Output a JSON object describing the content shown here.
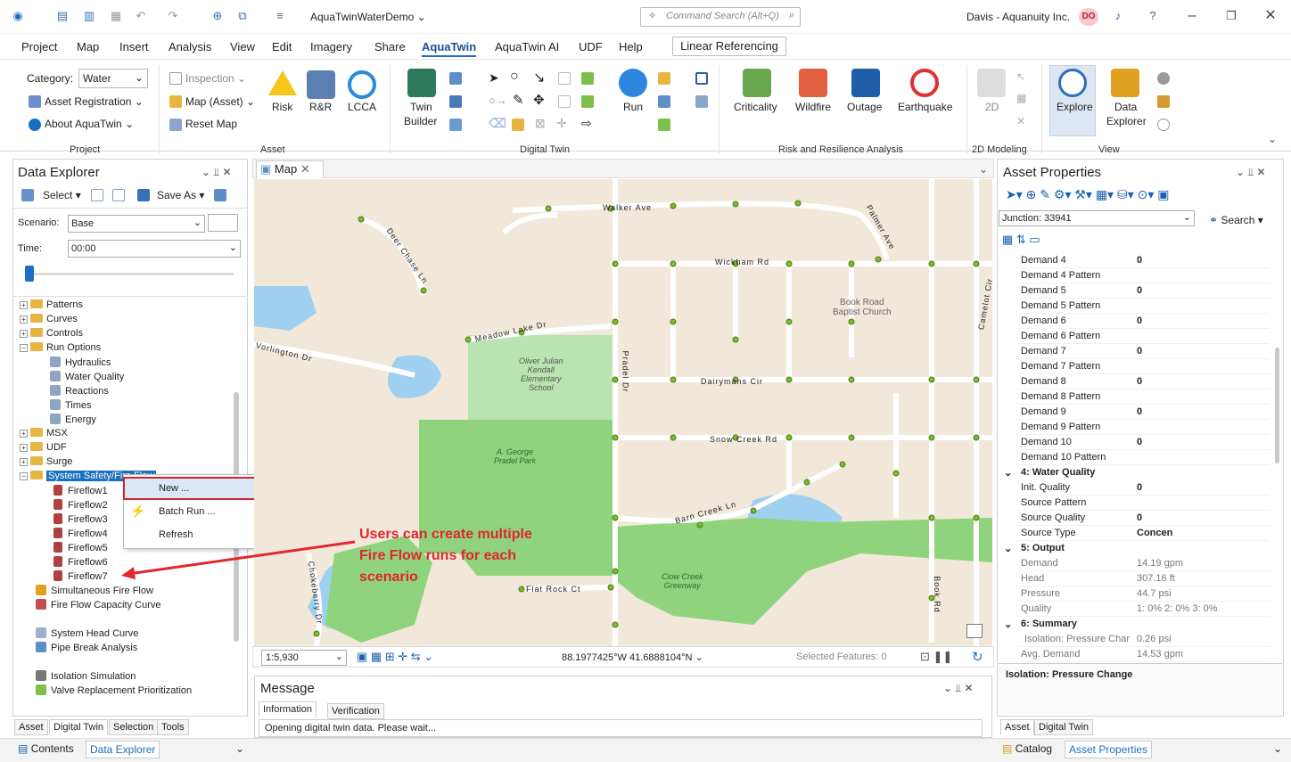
{
  "title_bar": {
    "app_name": "AquaTwinWaterDemo",
    "command_search": "Command Search (Alt+Q)",
    "org": "Davis - Aquanuity Inc.",
    "avatar": "DO"
  },
  "menu": [
    "Project",
    "Map",
    "Insert",
    "Analysis",
    "View",
    "Edit",
    "Imagery",
    "Share",
    "AquaTwin",
    "AquaTwin AI",
    "UDF",
    "Help"
  ],
  "linear_referencing": "Linear Referencing",
  "ribbon": {
    "project": {
      "category_label": "Category:",
      "category_value": "Water",
      "asset_registration": "Asset Registration",
      "about": "About AquaTwin",
      "group": "Project"
    },
    "asset": {
      "inspection": "Inspection",
      "map_asset": "Map (Asset)",
      "reset_map": "Reset Map",
      "risk": "Risk",
      "rr": "R&R",
      "lcca": "LCCA",
      "group": "Asset"
    },
    "digital_twin": {
      "twin_builder_1": "Twin",
      "twin_builder_2": "Builder",
      "run": "Run",
      "group": "Digital Twin"
    },
    "risk": {
      "criticality": "Criticality",
      "wildfire": "Wildfire",
      "outage": "Outage",
      "earthquake": "Earthquake",
      "group": "Risk and Resilience Analysis"
    },
    "modeling": {
      "two_d": "2D",
      "group": "2D Modeling"
    },
    "view": {
      "explore": "Explore",
      "data_explorer_1": "Data",
      "data_explorer_2": "Explorer",
      "group": "View"
    }
  },
  "data_explorer": {
    "title": "Data Explorer",
    "select": "Select",
    "save_as": "Save As",
    "scenario_label": "Scenario:",
    "scenario_value": "Base",
    "time_label": "Time:",
    "time_value": "00:00",
    "tree": [
      "Patterns",
      "Curves",
      "Controls",
      "Run Options",
      "Hydraulics",
      "Water Quality",
      "Reactions",
      "Times",
      "Energy",
      "MSX",
      "UDF",
      "Surge",
      "System Safety/Fire Flow",
      "Fireflow1",
      "Fireflow2",
      "Fireflow3",
      "Fireflow4",
      "Fireflow5",
      "Fireflow6",
      "Fireflow7",
      "Simultaneous Fire Flow",
      "Fire Flow Capacity Curve",
      "System Head Curve",
      "Pipe Break Analysis",
      "Isolation Simulation",
      "Valve Replacement Prioritization"
    ],
    "tabs": [
      "Asset",
      "Digital Twin",
      "Selection",
      "Tools"
    ],
    "bottom_tabs": [
      "Contents",
      "Data Explorer"
    ]
  },
  "context_menu": [
    "New ...",
    "Batch Run ...",
    "Refresh"
  ],
  "annotation": "Users can create multiple\nFire Flow runs for each\nscenario",
  "map": {
    "tab": "Map",
    "scale": "1:5,930",
    "coords": "88.1977425°W 41.6888104°N",
    "selected": "Selected Features: 0",
    "labels": [
      "Walker Ave",
      "Wickham Rd",
      "Book Road\nBaptist Church",
      "Meadow Lake Dr",
      "Vorlington Dr",
      "Oliver Julian\nKendall\nElementary\nSchool",
      "Pradel Dr",
      "Dairymans Cir",
      "Snow Creek Rd",
      "A. George\nPradel Park",
      "Barn Creek Ln",
      "Clow Creek\nGreenway",
      "Flat Rock Ct",
      "Chokeberry Dr",
      "Book Rd",
      "Camelot Cir",
      "Deer Chase Ln",
      "Palmer Ave"
    ]
  },
  "message": {
    "title": "Message",
    "tabs": [
      "Information",
      "Verification"
    ],
    "text": "Opening digital twin data.  Please wait..."
  },
  "asset_properties": {
    "title": "Asset Properties",
    "selector": "Junction: 33941",
    "search": "Search",
    "rows": [
      [
        "Demand  4",
        "0"
      ],
      [
        "Demand  4 Pattern",
        ""
      ],
      [
        "Demand  5",
        "0"
      ],
      [
        "Demand  5 Pattern",
        ""
      ],
      [
        "Demand  6",
        "0"
      ],
      [
        "Demand  6 Pattern",
        ""
      ],
      [
        "Demand  7",
        "0"
      ],
      [
        "Demand  7 Pattern",
        ""
      ],
      [
        "Demand  8",
        "0"
      ],
      [
        "Demand  8 Pattern",
        ""
      ],
      [
        "Demand  9",
        "0"
      ],
      [
        "Demand  9 Pattern",
        ""
      ],
      [
        "Demand 10",
        "0"
      ],
      [
        "Demand 10 Pattern",
        ""
      ]
    ],
    "cat_wq": "4: Water Quality",
    "wq_rows": [
      [
        "Init. Quality",
        "0"
      ],
      [
        "Source Pattern",
        ""
      ],
      [
        "Source Quality",
        "0"
      ],
      [
        "Source Type",
        "Concen"
      ]
    ],
    "cat_out": "5: Output",
    "out_rows": [
      [
        "Demand",
        "14.19 gpm"
      ],
      [
        "Head",
        "307.16 ft"
      ],
      [
        "Pressure",
        "44.7 psi"
      ],
      [
        "Quality",
        "1: 0% 2: 0% 3: 0%"
      ]
    ],
    "cat_sum": "6: Summary",
    "sum_rows": [
      [
        "Isolation: Pressure Char",
        "0.26 psi"
      ],
      [
        "Avg. Demand",
        "14.53 gpm"
      ]
    ],
    "desc": "Isolation: Pressure Change",
    "tabs": [
      "Asset",
      "Digital Twin"
    ],
    "bottom_tabs": [
      "Catalog",
      "Asset Properties"
    ]
  },
  "colors": {
    "accent": "#1a6fc0",
    "annotation": "#e0262e",
    "park": "#8fd47d",
    "school": "#b9e3b0",
    "water": "#9fd0f0",
    "land": "#f1e8da",
    "road": "#ffffff",
    "node": "#7dbb2e"
  }
}
